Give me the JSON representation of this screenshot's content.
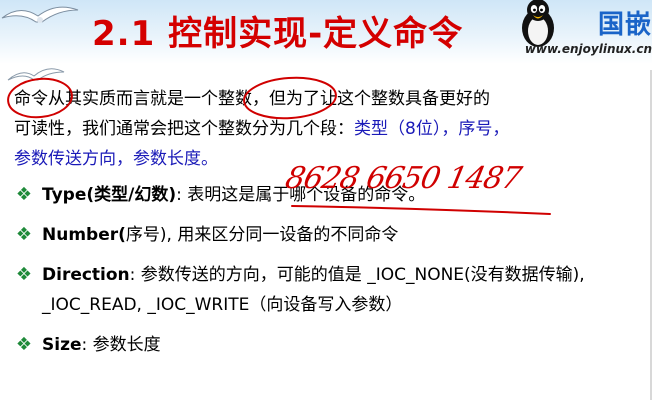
{
  "slide": {
    "title": "2.1 控制实现-定义命令",
    "logo_text": "国嵌",
    "site_url": "www.enjoylinux.cn"
  },
  "intro": {
    "line1": "命令从其实质而言就是一个整数，但为了让这个整数具备更好的",
    "line2": "可读性，我们通常会把这个整数分为几个段：",
    "segments_inline": "类型（8位），序号，",
    "line3": "参数传送方向，参数长度。"
  },
  "bullets": [
    {
      "term": "Type(类型/幻数)",
      "desc": ": 表明这是属于哪个设备的命令。"
    },
    {
      "term": "Number(",
      "desc": "序号), 用来区分同一设备的不同命令"
    },
    {
      "term": "Direction",
      "desc": ":  参数传送的方向，可能的值是 _IOC_NONE(没有数据传输), _IOC_READ, _IOC_WRITE（向设备写入参数）"
    },
    {
      "term": "Size",
      "desc": ":   参数长度"
    }
  ],
  "annotation": {
    "handwritten_number": "8628 6650 1487"
  },
  "colors": {
    "title": "#d40000",
    "highlight_text": "#1a1ab8",
    "bullet": "#1f8a3a",
    "ink": "#d00000"
  },
  "icons": [
    "seagull-icon",
    "penguin-icon",
    "diamond-bullet-icon"
  ]
}
